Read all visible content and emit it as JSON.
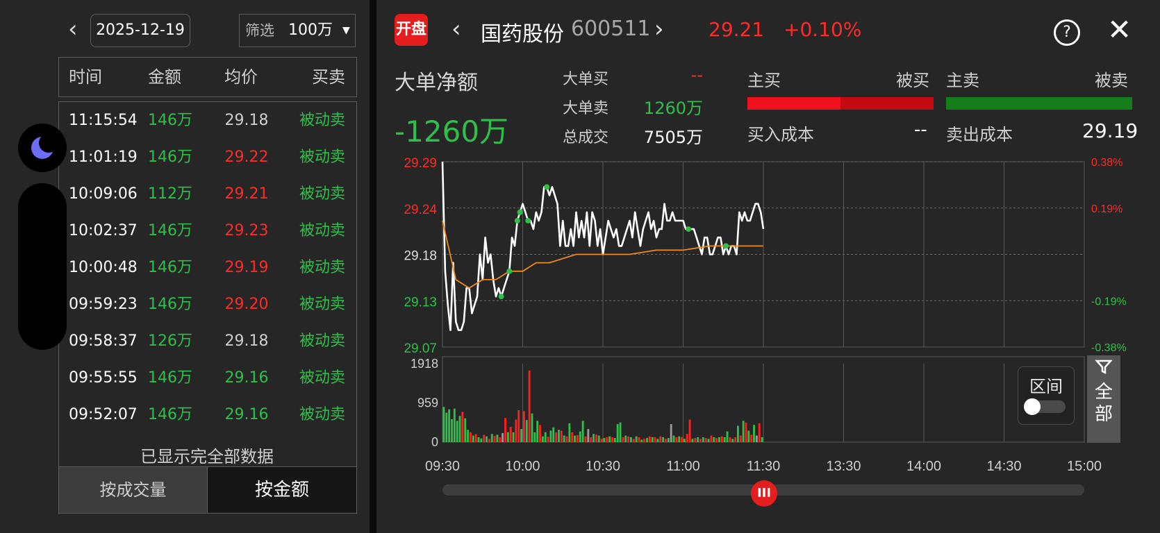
{
  "left": {
    "date": "2025-12-19",
    "filter_label": "筛选",
    "filter_value": "100万",
    "columns": [
      "时间",
      "金额",
      "均价",
      "买卖"
    ],
    "rows": [
      {
        "time": "11:15:54",
        "amount": "146万",
        "avg": "29.18",
        "side": "被动卖",
        "avg_color": "gray"
      },
      {
        "time": "11:01:19",
        "amount": "146万",
        "avg": "29.22",
        "side": "被动卖",
        "avg_color": "red"
      },
      {
        "time": "10:09:06",
        "amount": "112万",
        "avg": "29.21",
        "side": "被动卖",
        "avg_color": "red"
      },
      {
        "time": "10:02:37",
        "amount": "146万",
        "avg": "29.23",
        "side": "被动卖",
        "avg_color": "red"
      },
      {
        "time": "10:00:48",
        "amount": "146万",
        "avg": "29.19",
        "side": "被动卖",
        "avg_color": "red"
      },
      {
        "time": "09:59:23",
        "amount": "146万",
        "avg": "29.20",
        "side": "被动卖",
        "avg_color": "red"
      },
      {
        "time": "09:58:37",
        "amount": "126万",
        "avg": "29.18",
        "side": "被动卖",
        "avg_color": "gray"
      },
      {
        "time": "09:55:55",
        "amount": "146万",
        "avg": "29.16",
        "side": "被动卖",
        "avg_color": "green"
      },
      {
        "time": "09:52:07",
        "amount": "146万",
        "avg": "29.16",
        "side": "被动卖",
        "avg_color": "green"
      }
    ],
    "all_shown": "已显示完全部数据",
    "btn_volume": "按成交量",
    "btn_amount": "按金额"
  },
  "header": {
    "logo_text": "开盘",
    "stock_name": "国药股份",
    "stock_code": "600511",
    "price": "29.21",
    "change": "+0.10%"
  },
  "stats": {
    "net_title": "大单净额",
    "net_value": "-1260万",
    "big_buy_label": "大单买",
    "big_buy_value": "--",
    "big_sell_label": "大单卖",
    "big_sell_value": "1260万",
    "total_label": "总成交",
    "total_value": "7505万",
    "main_buy": "主买",
    "passive_buy": "被买",
    "main_sell": "主卖",
    "passive_sell": "被卖",
    "buy_cost_label": "买入成本",
    "buy_cost_value": "--",
    "sell_cost_label": "卖出成本",
    "sell_cost_value": "29.19"
  },
  "controls": {
    "range_label": "区间",
    "all_label_1": "全",
    "all_label_2": "部",
    "slider_icon": "III",
    "help_icon": "?",
    "close_icon": "✕"
  },
  "colors": {
    "up": "#ff2a2a",
    "down": "#2fbf4a",
    "price_line": "#ffffff",
    "avg_line": "#f08a1c"
  },
  "chart_data": [
    {
      "type": "line",
      "y_ticks_left": [
        "29.29",
        "29.24",
        "29.18",
        "29.13",
        "29.07"
      ],
      "y_ticks_right": [
        "0.38%",
        "0.19%",
        "",
        "-0.19%",
        "-0.38%"
      ],
      "x_ticks": [
        "09:30",
        "10:00",
        "10:30",
        "11:00",
        "11:30",
        "13:30",
        "14:00",
        "14:30",
        "15:00"
      ],
      "ylim": [
        29.07,
        29.29
      ],
      "x_minutes_total": 240,
      "series": [
        {
          "x": [
            0,
            1,
            2,
            3,
            4,
            5,
            6,
            7,
            8,
            9,
            10,
            11,
            12,
            13,
            14,
            15,
            16,
            17,
            18,
            19,
            20,
            21,
            22,
            23,
            24,
            25,
            26,
            27,
            28,
            29,
            30,
            31,
            32,
            33,
            34,
            35,
            36,
            37,
            38,
            39,
            40,
            41,
            42,
            43,
            44,
            45,
            46,
            47,
            48,
            49,
            50,
            51,
            52,
            53,
            54,
            55,
            56,
            57,
            58,
            59,
            60,
            61,
            62,
            63,
            64,
            65,
            66,
            67,
            68,
            69,
            70,
            71,
            72,
            73,
            74,
            75,
            76,
            77,
            78,
            79,
            80,
            81,
            82,
            83,
            84,
            85,
            86,
            87,
            88,
            89,
            90,
            91,
            92,
            93,
            94,
            95,
            96,
            97,
            98,
            99,
            100,
            101,
            102,
            103,
            104,
            105,
            106,
            107,
            108,
            109,
            110,
            111,
            112,
            113,
            114,
            115,
            116,
            117,
            118,
            119,
            120
          ],
          "values": [
            29.29,
            29.16,
            29.12,
            29.09,
            29.17,
            29.1,
            29.09,
            29.09,
            29.1,
            29.14,
            29.14,
            29.11,
            29.12,
            29.13,
            29.18,
            29.15,
            29.2,
            29.17,
            29.18,
            29.15,
            29.13,
            29.14,
            29.13,
            29.14,
            29.15,
            29.16,
            29.2,
            29.19,
            29.22,
            29.23,
            29.24,
            29.23,
            29.22,
            29.22,
            29.21,
            29.23,
            29.22,
            29.23,
            29.26,
            29.26,
            29.25,
            29.26,
            29.25,
            29.24,
            29.19,
            29.22,
            29.19,
            29.19,
            29.21,
            29.19,
            29.23,
            29.2,
            29.22,
            29.2,
            29.23,
            29.19,
            29.23,
            29.22,
            29.19,
            29.21,
            29.18,
            29.2,
            29.22,
            29.21,
            29.2,
            29.21,
            29.19,
            29.19,
            29.2,
            29.21,
            29.22,
            29.2,
            29.23,
            29.21,
            29.19,
            29.21,
            29.22,
            29.23,
            29.21,
            29.22,
            29.2,
            29.21,
            29.21,
            29.24,
            29.22,
            29.22,
            29.23,
            29.22,
            29.22,
            29.22,
            29.22,
            29.21,
            29.21,
            29.21,
            29.21,
            29.2,
            29.19,
            29.18,
            29.2,
            29.2,
            29.18,
            29.18,
            29.19,
            29.2,
            29.2,
            29.18,
            29.19,
            29.18,
            29.19,
            29.19,
            29.18,
            29.23,
            29.22,
            29.23,
            29.22,
            29.22,
            29.23,
            29.24,
            29.24,
            29.23,
            29.21
          ]
        },
        {
          "x": [
            0,
            5,
            10,
            15,
            20,
            25,
            30,
            35,
            40,
            50,
            60,
            70,
            80,
            90,
            100,
            110,
            120
          ],
          "values": [
            29.22,
            29.15,
            29.14,
            29.15,
            29.15,
            29.16,
            29.16,
            29.17,
            29.17,
            29.18,
            29.18,
            29.18,
            29.185,
            29.185,
            29.19,
            29.19,
            29.19
          ]
        }
      ],
      "markers_x": [
        22,
        25,
        28,
        29,
        29,
        32,
        39,
        92,
        106
      ]
    },
    {
      "type": "bar",
      "y_ticks": [
        "1918",
        "959",
        "0"
      ],
      "ylim": [
        0,
        1918
      ],
      "values": [
        860,
        720,
        800,
        560,
        820,
        520,
        640,
        740,
        580,
        300,
        240,
        160,
        200,
        120,
        90,
        180,
        140,
        80,
        200,
        150,
        180,
        120,
        220,
        590,
        240,
        370,
        240,
        550,
        780,
        320,
        760,
        540,
        1750,
        700,
        240,
        520,
        420,
        140,
        240,
        130,
        280,
        360,
        240,
        300,
        280,
        160,
        140,
        460,
        240,
        160,
        170,
        260,
        520,
        140,
        320,
        120,
        200,
        180,
        160,
        80,
        100,
        120,
        140,
        120,
        100,
        440,
        480,
        120,
        160,
        140,
        120,
        80,
        140,
        120,
        60,
        80,
        100,
        140,
        120,
        120,
        80,
        140,
        120,
        80,
        100,
        440,
        160,
        120,
        140,
        120,
        80,
        200,
        550,
        80,
        100,
        120,
        80,
        120,
        100,
        80,
        160,
        120,
        100,
        120,
        140,
        120,
        260,
        120,
        80,
        120,
        400,
        160,
        520,
        480,
        280,
        180,
        420,
        160,
        460,
        120
      ],
      "colors": [
        "g",
        "g",
        "g",
        "g",
        "g",
        "g",
        "g",
        "r",
        "g",
        "g",
        "r",
        "g",
        "r",
        "g",
        "g",
        "r",
        "g",
        "r",
        "g",
        "r",
        "g",
        "r",
        "gr",
        "r",
        "g",
        "r",
        "g",
        "r",
        "r",
        "g",
        "r",
        "g",
        "r",
        "g",
        "g",
        "g",
        "r",
        "g",
        "g",
        "r",
        "g",
        "g",
        "r",
        "g",
        "r",
        "g",
        "r",
        "g",
        "r",
        "g",
        "r",
        "g",
        "g",
        "r",
        "gr",
        "r",
        "g",
        "r",
        "g",
        "r",
        "g",
        "r",
        "g",
        "r",
        "g",
        "g",
        "g",
        "r",
        "g",
        "r",
        "g",
        "r",
        "g",
        "r",
        "g",
        "r",
        "g",
        "r",
        "g",
        "r",
        "g",
        "r",
        "g",
        "r",
        "g",
        "gr",
        "g",
        "r",
        "g",
        "r",
        "g",
        "r",
        "r",
        "g",
        "r",
        "g",
        "r",
        "g",
        "r",
        "g",
        "r",
        "g",
        "r",
        "g",
        "r",
        "g",
        "g",
        "r",
        "g",
        "r",
        "g",
        "r",
        "g",
        "r",
        "g",
        "r",
        "g",
        "gr",
        "r",
        "g",
        "g"
      ]
    }
  ]
}
